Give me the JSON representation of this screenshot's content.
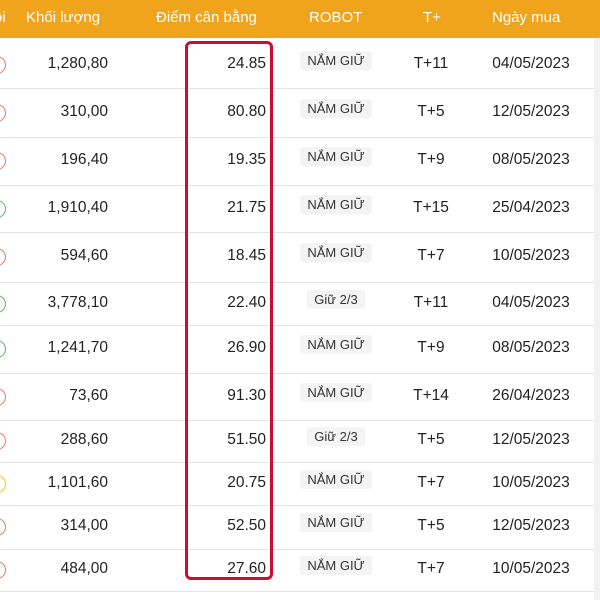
{
  "header": {
    "partial_label": "ỗi",
    "volume": "Khối lượng",
    "balance_point": "Điểm cân bằng",
    "robot": "ROBOT",
    "tplus": "T+",
    "buy_date": "Ngày mua"
  },
  "colors": {
    "header_bg": "#f0a41c",
    "highlight_border": "#c8102e",
    "dot_red": "#e67a6b",
    "dot_green": "#5cb85c",
    "dot_yellow": "#f0c419"
  },
  "rows": [
    {
      "volume": "1,280,80",
      "point": "24.85",
      "robot": "NẮM GIỮ",
      "tplus": "T+11",
      "date": "04/05/2023",
      "dot": "red"
    },
    {
      "volume": "310,00",
      "point": "80.80",
      "robot": "NẮM GIỮ",
      "tplus": "T+5",
      "date": "12/05/2023",
      "dot": "red"
    },
    {
      "volume": "196,40",
      "point": "19.35",
      "robot": "NẮM GIỮ",
      "tplus": "T+9",
      "date": "08/05/2023",
      "dot": "red"
    },
    {
      "volume": "1,910,40",
      "point": "21.75",
      "robot": "NẮM GIỮ",
      "tplus": "T+15",
      "date": "25/04/2023",
      "dot": "green"
    },
    {
      "volume": "594,60",
      "point": "18.45",
      "robot": "NẮM GIỮ",
      "tplus": "T+7",
      "date": "10/05/2023",
      "dot": "red"
    },
    {
      "volume": "3,778,10",
      "point": "22.40",
      "robot": "Giữ 2/3",
      "tplus": "T+11",
      "date": "04/05/2023",
      "dot": "green"
    },
    {
      "volume": "1,241,70",
      "point": "26.90",
      "robot": "NẮM GIỮ",
      "tplus": "T+9",
      "date": "08/05/2023",
      "dot": "green"
    },
    {
      "volume": "73,60",
      "point": "91.30",
      "robot": "NẮM GIỮ",
      "tplus": "T+14",
      "date": "26/04/2023",
      "dot": "red"
    },
    {
      "volume": "288,60",
      "point": "51.50",
      "robot": "Giữ 2/3",
      "tplus": "T+5",
      "date": "12/05/2023",
      "dot": "red"
    },
    {
      "volume": "1,101,60",
      "point": "20.75",
      "robot": "NẮM GIỮ",
      "tplus": "T+7",
      "date": "10/05/2023",
      "dot": "yellow"
    },
    {
      "volume": "314,00",
      "point": "52.50",
      "robot": "NẮM GIỮ",
      "tplus": "T+5",
      "date": "12/05/2023",
      "dot": "red"
    },
    {
      "volume": "484,00",
      "point": "27.60",
      "robot": "NẮM GIỮ",
      "tplus": "T+7",
      "date": "10/05/2023",
      "dot": "red"
    }
  ]
}
